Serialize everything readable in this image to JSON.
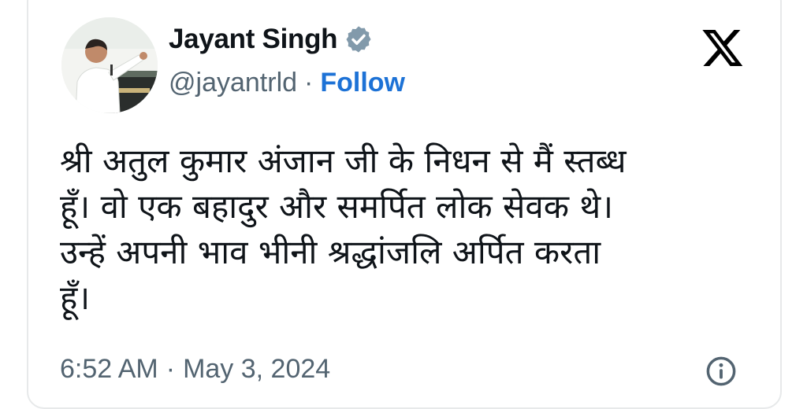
{
  "author": {
    "name": "Jayant Singh",
    "handle": "@jayantrld",
    "separator": "·",
    "follow_label": "Follow",
    "verified_icon": "verified-badge-icon",
    "verified_color": "#829aab"
  },
  "platform_icon": "x-logo-icon",
  "tweet": {
    "lines": [
      "श्री अतुल कुमार अंजान जी के निधन से मैं स्तब्ध",
      "हूँ। वो एक बहादुर और समर्पित लोक सेवक थे।",
      "उन्हें अपनी भाव भीनी श्रद्धांजलि अर्पित करता",
      "हूँ।"
    ]
  },
  "meta": {
    "time": "6:52 AM",
    "separator": "·",
    "date": "May 3, 2024",
    "info_icon": "info-icon"
  },
  "colors": {
    "text": "#0f1419",
    "secondary": "#536471",
    "link": "#1d72d6",
    "border": "#e7e9ea"
  }
}
